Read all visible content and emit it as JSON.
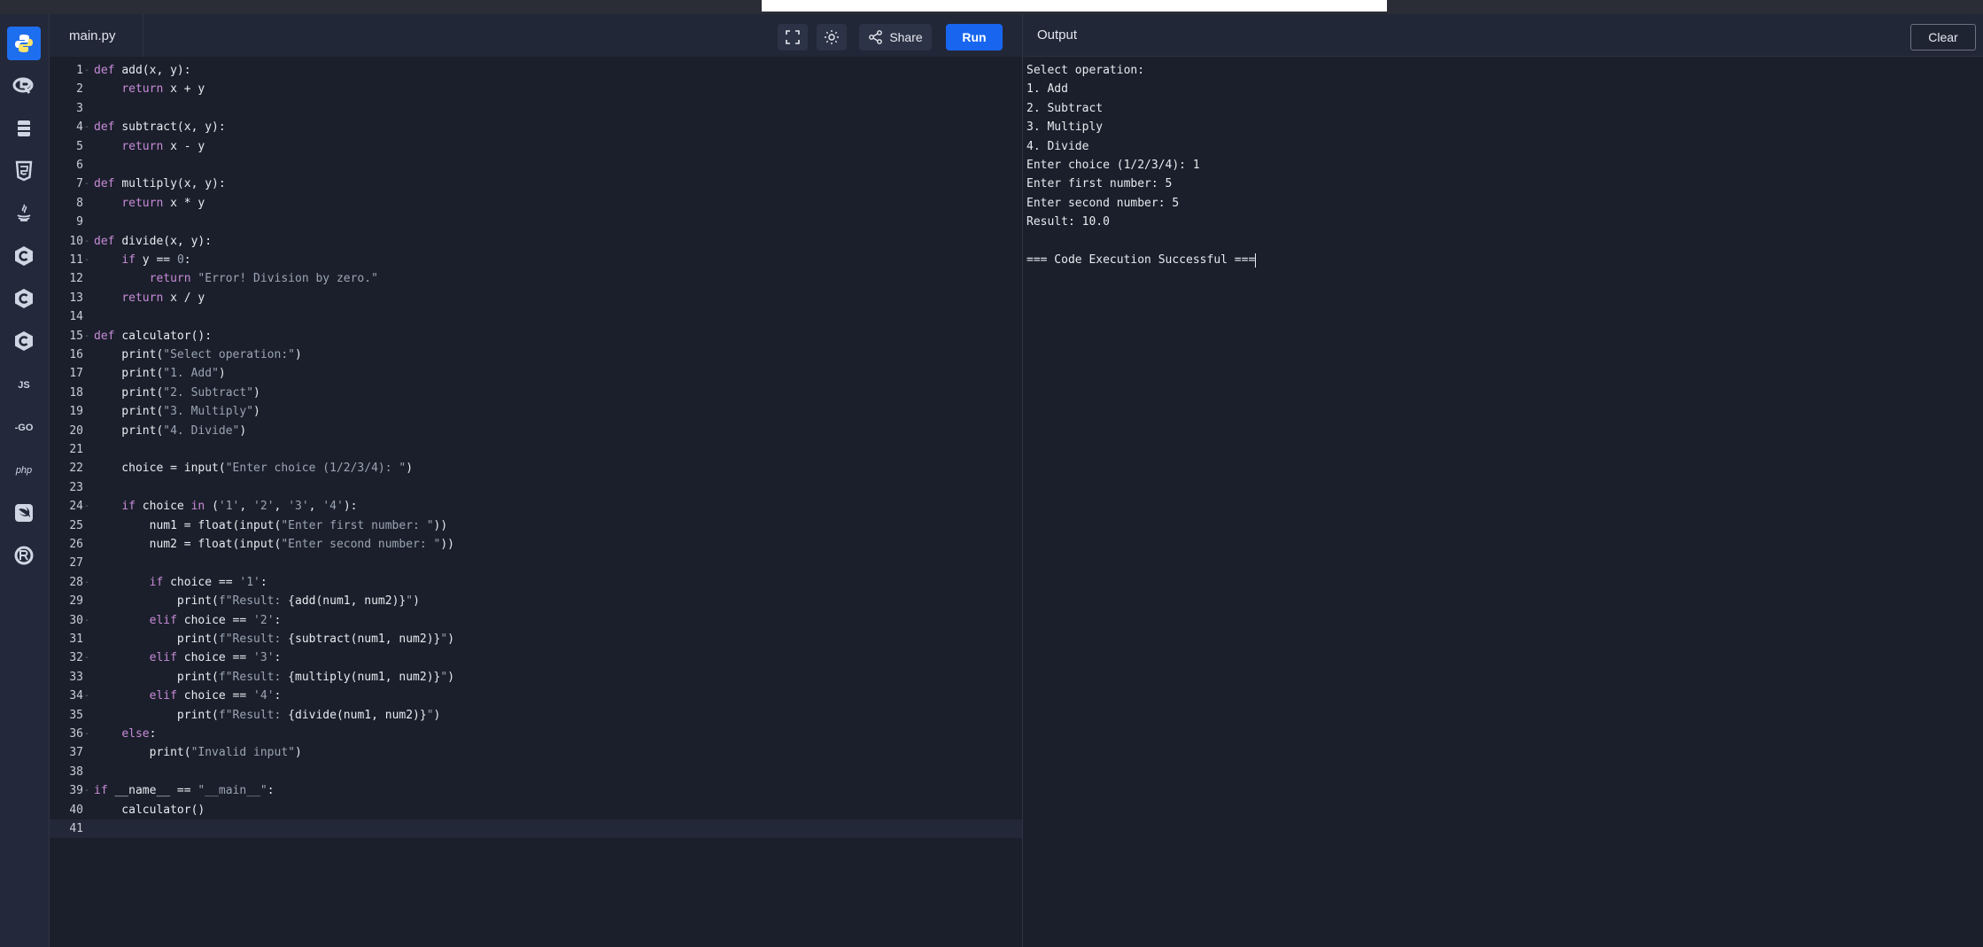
{
  "editor": {
    "filename": "main.py",
    "share_label": "Share",
    "run_label": "Run",
    "lines": [
      {
        "n": "1",
        "fold": true,
        "code": [
          [
            "kw",
            "def "
          ],
          [
            "fn",
            "add(x, y):"
          ]
        ]
      },
      {
        "n": "2",
        "code": [
          [
            "fn",
            "    "
          ],
          [
            "kw",
            "return "
          ],
          [
            "fn",
            "x + y"
          ]
        ]
      },
      {
        "n": "3",
        "code": []
      },
      {
        "n": "4",
        "fold": true,
        "code": [
          [
            "kw",
            "def "
          ],
          [
            "fn",
            "subtract(x, y):"
          ]
        ]
      },
      {
        "n": "5",
        "code": [
          [
            "fn",
            "    "
          ],
          [
            "kw",
            "return "
          ],
          [
            "fn",
            "x - y"
          ]
        ]
      },
      {
        "n": "6",
        "code": []
      },
      {
        "n": "7",
        "fold": true,
        "code": [
          [
            "kw",
            "def "
          ],
          [
            "fn",
            "multiply(x, y):"
          ]
        ]
      },
      {
        "n": "8",
        "code": [
          [
            "fn",
            "    "
          ],
          [
            "kw",
            "return "
          ],
          [
            "fn",
            "x * y"
          ]
        ]
      },
      {
        "n": "9",
        "code": []
      },
      {
        "n": "10",
        "fold": true,
        "code": [
          [
            "kw",
            "def "
          ],
          [
            "fn",
            "divide(x, y):"
          ]
        ]
      },
      {
        "n": "11",
        "fold": true,
        "code": [
          [
            "fn",
            "    "
          ],
          [
            "kw",
            "if "
          ],
          [
            "fn",
            "y == "
          ],
          [
            "str",
            "0"
          ],
          [
            "fn",
            ":"
          ]
        ]
      },
      {
        "n": "12",
        "code": [
          [
            "fn",
            "        "
          ],
          [
            "kw",
            "return "
          ],
          [
            "str",
            "\"Error! Division by zero.\""
          ]
        ]
      },
      {
        "n": "13",
        "code": [
          [
            "fn",
            "    "
          ],
          [
            "kw",
            "return "
          ],
          [
            "fn",
            "x / y"
          ]
        ]
      },
      {
        "n": "14",
        "code": []
      },
      {
        "n": "15",
        "fold": true,
        "code": [
          [
            "kw",
            "def "
          ],
          [
            "fn",
            "calculator():"
          ]
        ]
      },
      {
        "n": "16",
        "code": [
          [
            "fn",
            "    print("
          ],
          [
            "str",
            "\"Select operation:\""
          ],
          [
            "fn",
            ")"
          ]
        ]
      },
      {
        "n": "17",
        "code": [
          [
            "fn",
            "    print("
          ],
          [
            "str",
            "\"1. Add\""
          ],
          [
            "fn",
            ")"
          ]
        ]
      },
      {
        "n": "18",
        "code": [
          [
            "fn",
            "    print("
          ],
          [
            "str",
            "\"2. Subtract\""
          ],
          [
            "fn",
            ")"
          ]
        ]
      },
      {
        "n": "19",
        "code": [
          [
            "fn",
            "    print("
          ],
          [
            "str",
            "\"3. Multiply\""
          ],
          [
            "fn",
            ")"
          ]
        ]
      },
      {
        "n": "20",
        "code": [
          [
            "fn",
            "    print("
          ],
          [
            "str",
            "\"4. Divide\""
          ],
          [
            "fn",
            ")"
          ]
        ]
      },
      {
        "n": "21",
        "code": []
      },
      {
        "n": "22",
        "code": [
          [
            "fn",
            "    choice = input("
          ],
          [
            "str",
            "\"Enter choice (1/2/3/4): \""
          ],
          [
            "fn",
            ")"
          ]
        ]
      },
      {
        "n": "23",
        "code": []
      },
      {
        "n": "24",
        "fold": true,
        "code": [
          [
            "fn",
            "    "
          ],
          [
            "kw",
            "if "
          ],
          [
            "fn",
            "choice "
          ],
          [
            "kw",
            "in "
          ],
          [
            "fn",
            "("
          ],
          [
            "str",
            "'1'"
          ],
          [
            "fn",
            ", "
          ],
          [
            "str",
            "'2'"
          ],
          [
            "fn",
            ", "
          ],
          [
            "str",
            "'3'"
          ],
          [
            "fn",
            ", "
          ],
          [
            "str",
            "'4'"
          ],
          [
            "fn",
            "):"
          ]
        ]
      },
      {
        "n": "25",
        "code": [
          [
            "fn",
            "        num1 = float(input("
          ],
          [
            "str",
            "\"Enter first number: \""
          ],
          [
            "fn",
            "))"
          ]
        ]
      },
      {
        "n": "26",
        "code": [
          [
            "fn",
            "        num2 = float(input("
          ],
          [
            "str",
            "\"Enter second number: \""
          ],
          [
            "fn",
            "))"
          ]
        ]
      },
      {
        "n": "27",
        "code": []
      },
      {
        "n": "28",
        "fold": true,
        "code": [
          [
            "fn",
            "        "
          ],
          [
            "kw",
            "if "
          ],
          [
            "fn",
            "choice == "
          ],
          [
            "str",
            "'1'"
          ],
          [
            "fn",
            ":"
          ]
        ]
      },
      {
        "n": "29",
        "code": [
          [
            "fn",
            "            print("
          ],
          [
            "str",
            "f\"Result: "
          ],
          [
            "fn",
            "{add(num1, num2)}"
          ],
          [
            "str",
            "\""
          ],
          [
            "fn",
            ")"
          ]
        ]
      },
      {
        "n": "30",
        "fold": true,
        "code": [
          [
            "fn",
            "        "
          ],
          [
            "kw",
            "elif "
          ],
          [
            "fn",
            "choice == "
          ],
          [
            "str",
            "'2'"
          ],
          [
            "fn",
            ":"
          ]
        ]
      },
      {
        "n": "31",
        "code": [
          [
            "fn",
            "            print("
          ],
          [
            "str",
            "f\"Result: "
          ],
          [
            "fn",
            "{subtract(num1, num2)}"
          ],
          [
            "str",
            "\""
          ],
          [
            "fn",
            ")"
          ]
        ]
      },
      {
        "n": "32",
        "fold": true,
        "code": [
          [
            "fn",
            "        "
          ],
          [
            "kw",
            "elif "
          ],
          [
            "fn",
            "choice == "
          ],
          [
            "str",
            "'3'"
          ],
          [
            "fn",
            ":"
          ]
        ]
      },
      {
        "n": "33",
        "code": [
          [
            "fn",
            "            print("
          ],
          [
            "str",
            "f\"Result: "
          ],
          [
            "fn",
            "{multiply(num1, num2)}"
          ],
          [
            "str",
            "\""
          ],
          [
            "fn",
            ")"
          ]
        ]
      },
      {
        "n": "34",
        "fold": true,
        "code": [
          [
            "fn",
            "        "
          ],
          [
            "kw",
            "elif "
          ],
          [
            "fn",
            "choice == "
          ],
          [
            "str",
            "'4'"
          ],
          [
            "fn",
            ":"
          ]
        ]
      },
      {
        "n": "35",
        "code": [
          [
            "fn",
            "            print("
          ],
          [
            "str",
            "f\"Result: "
          ],
          [
            "fn",
            "{divide(num1, num2)}"
          ],
          [
            "str",
            "\""
          ],
          [
            "fn",
            ")"
          ]
        ]
      },
      {
        "n": "36",
        "fold": true,
        "code": [
          [
            "fn",
            "    "
          ],
          [
            "kw",
            "else"
          ],
          [
            "fn",
            ":"
          ]
        ]
      },
      {
        "n": "37",
        "code": [
          [
            "fn",
            "        print("
          ],
          [
            "str",
            "\"Invalid input\""
          ],
          [
            "fn",
            ")"
          ]
        ]
      },
      {
        "n": "38",
        "code": []
      },
      {
        "n": "39",
        "fold": true,
        "code": [
          [
            "kw",
            "if "
          ],
          [
            "fn",
            "__name__ == "
          ],
          [
            "str",
            "\"__main__\""
          ],
          [
            "fn",
            ":"
          ]
        ]
      },
      {
        "n": "40",
        "code": [
          [
            "fn",
            "    calculator()"
          ]
        ]
      },
      {
        "n": "41",
        "active": true,
        "code": []
      }
    ]
  },
  "output": {
    "title": "Output",
    "clear_label": "Clear",
    "lines": [
      "Select operation:",
      "1. Add",
      "2. Subtract",
      "3. Multiply",
      "4. Divide",
      "Enter choice (1/2/3/4): 1",
      "Enter first number: 5",
      "Enter second number: 5",
      "Result: 10.0",
      "",
      "=== Code Execution Successful ==="
    ]
  },
  "sidebar": {
    "items": [
      {
        "icon": "python-icon",
        "active": true
      },
      {
        "icon": "r-lang-icon"
      },
      {
        "icon": "sql-database-icon"
      },
      {
        "icon": "html5-icon"
      },
      {
        "icon": "java-icon"
      },
      {
        "icon": "c-lang-icon"
      },
      {
        "icon": "cpp-lang-icon"
      },
      {
        "icon": "csharp-lang-icon"
      },
      {
        "icon": "javascript-icon",
        "text": "JS"
      },
      {
        "icon": "go-lang-icon",
        "text": "-GO"
      },
      {
        "icon": "php-icon",
        "text": "php"
      },
      {
        "icon": "swift-icon"
      },
      {
        "icon": "rust-icon"
      }
    ]
  },
  "colors": {
    "accent": "#1866f0",
    "keyword": "#c78bd8",
    "string": "#9aa4b4"
  }
}
